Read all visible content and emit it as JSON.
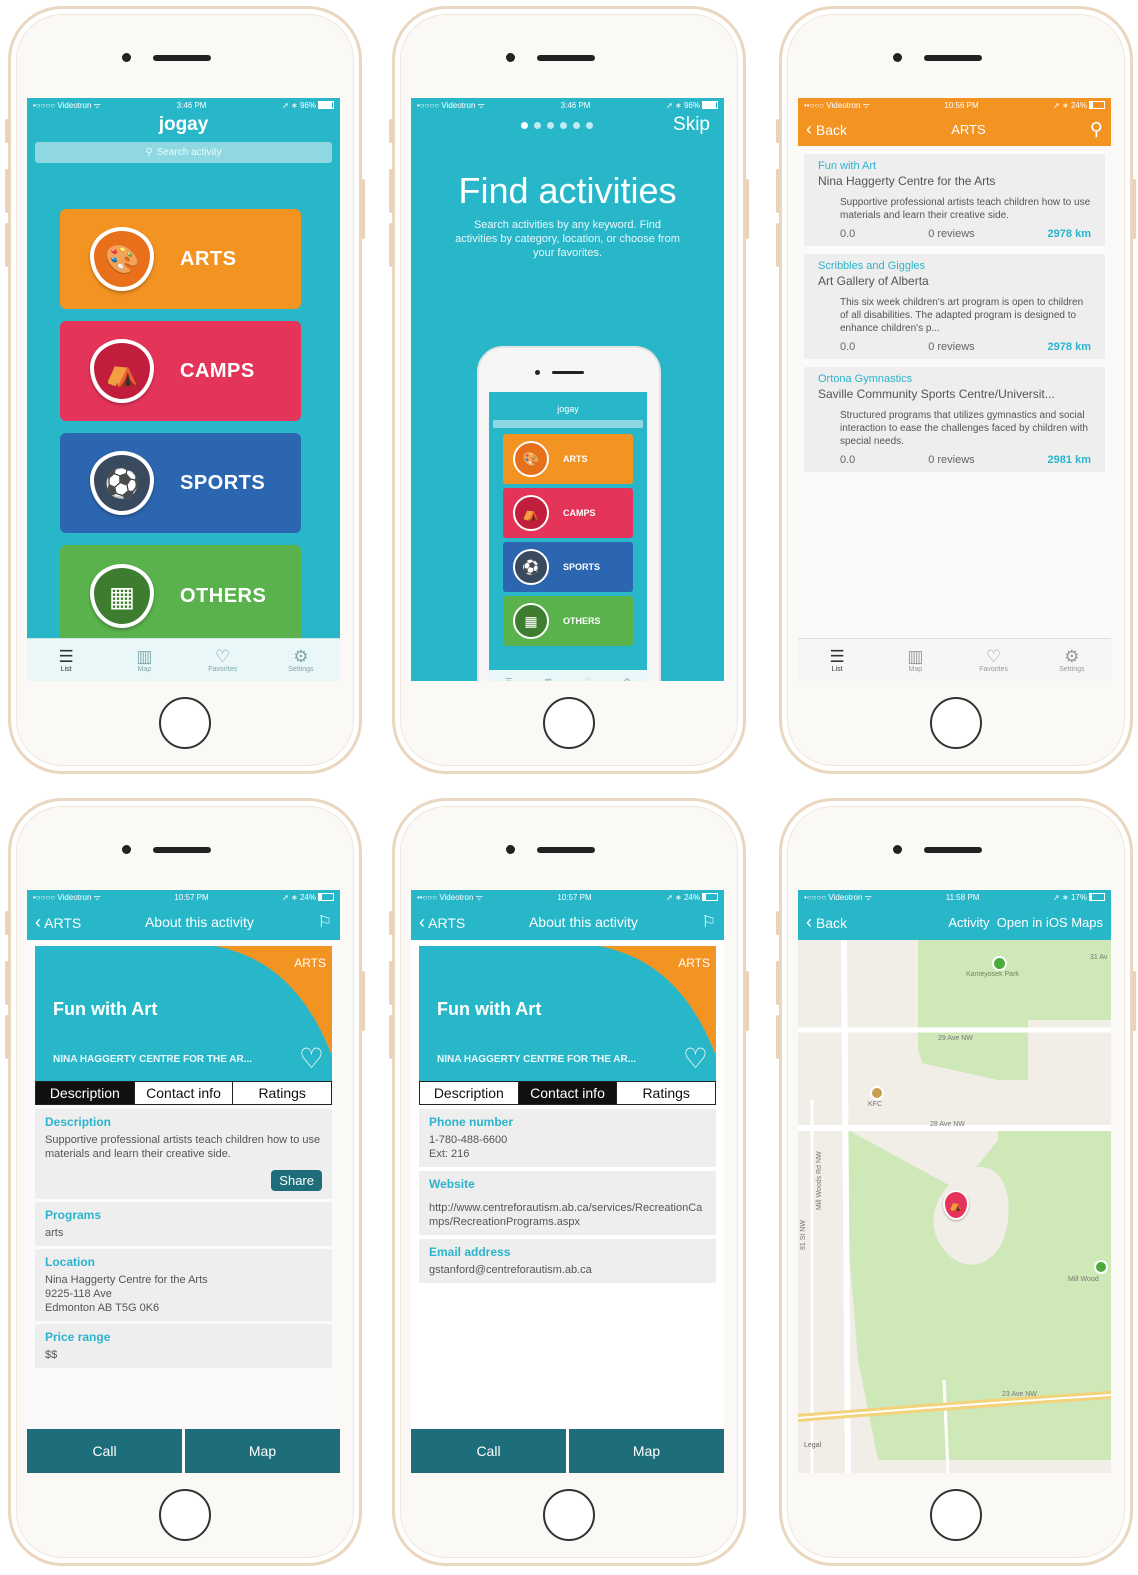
{
  "colors": {
    "teal": "#28b7c9",
    "orange": "#f39322",
    "red": "#e5345a",
    "blue": "#2c66b0",
    "green": "#5ab24c",
    "dark_teal": "#1d6e7a"
  },
  "status": {
    "s1": {
      "carrier": "•○○○○ Videotron ᯤ",
      "time": "3:46 PM",
      "right": "➚ ∗ 96%"
    },
    "s2": {
      "carrier": "•○○○○ Videotron ᯤ",
      "time": "3:46 PM",
      "right": "➚ ∗ 96%"
    },
    "s3": {
      "carrier": "••○○○ Videotron ᯤ",
      "time": "10:56 PM",
      "right": "➚ ∗ 24%"
    },
    "s4": {
      "carrier": "•○○○○ Videotron ᯤ",
      "time": "10:57 PM",
      "right": "➚ ∗ 24%"
    },
    "s5": {
      "carrier": "••○○○ Videotron ᯤ",
      "time": "10:57 PM",
      "right": "➚ ∗ 24%"
    },
    "s6": {
      "carrier": "•○○○○ Videotron ᯤ",
      "time": "11:58 PM",
      "right": "➚ ∗ 17%"
    }
  },
  "home": {
    "logo": "jogay",
    "search_placeholder": "Search activity",
    "categories": [
      {
        "label": "ARTS",
        "icon": "palette-icon",
        "glyph": "🎨"
      },
      {
        "label": "CAMPS",
        "icon": "tent-icon",
        "glyph": "⛺"
      },
      {
        "label": "SPORTS",
        "icon": "basketball-icon",
        "glyph": "⚽"
      },
      {
        "label": "OTHERS",
        "icon": "theater-icon",
        "glyph": "▦"
      }
    ]
  },
  "tabs": [
    {
      "label": "List",
      "glyph": "☰"
    },
    {
      "label": "Map",
      "glyph": "▥"
    },
    {
      "label": "Favorites",
      "glyph": "♡"
    },
    {
      "label": "Settings",
      "glyph": "⚙"
    }
  ],
  "onboarding": {
    "skip": "Skip",
    "title": "Find activities",
    "subtitle": "Search activities by any keyword. Find activities by category, location, or choose from your favorites.",
    "mini_logo": "jogay",
    "mini_categories": [
      "ARTS",
      "CAMPS",
      "SPORTS",
      "OTHERS"
    ]
  },
  "list": {
    "back": "Back",
    "title": "ARTS",
    "items": [
      {
        "title": "Fun with Art",
        "venue": "Nina Haggerty Centre for the Arts",
        "desc": "Supportive professional artists teach children how to use materials and learn their creative side.",
        "rating": "0.0",
        "reviews": "0 reviews",
        "distance": "2978 km"
      },
      {
        "title": "Scribbles and Giggles",
        "venue": "Art Gallery of Alberta",
        "desc": "This six week children's art program is open to children of all disabilities. The adapted program is designed to enhance children's p...",
        "rating": "0.0",
        "reviews": "0 reviews",
        "distance": "2978 km"
      },
      {
        "title": "Ortona Gymnastics",
        "venue": "Saville Community Sports Centre/Universit...",
        "desc": "Structured programs that utilizes gymnastics and social interaction to ease the challenges faced by children with special needs.",
        "rating": "0.0",
        "reviews": "0 reviews",
        "distance": "2981 km"
      }
    ]
  },
  "detail": {
    "back": "ARTS",
    "title": "About this activity",
    "category": "ARTS",
    "activity": "Fun with Art",
    "venue": "NINA HAGGERTY CENTRE FOR THE AR...",
    "segments": [
      "Description",
      "Contact info",
      "Ratings"
    ],
    "description_h": "Description",
    "description": "Supportive professional artists teach children how to use materials and learn their creative side.",
    "share": "Share",
    "programs_h": "Programs",
    "programs": "arts",
    "location_h": "Location",
    "location": [
      "Nina Haggerty Centre for the Arts",
      "9225-118 Ave",
      "Edmonton AB T5G 0K6"
    ],
    "price_h": "Price range",
    "price": "$$",
    "call": "Call",
    "map": "Map"
  },
  "contact": {
    "phone_h": "Phone number",
    "phone": [
      "1-780-488-6600",
      "Ext: 216"
    ],
    "website_h": "Website",
    "website": "http://www.centreforautism.ab.ca/services/RecreationCamps/RecreationPrograms.aspx",
    "email_h": "Email address",
    "email": "gstanford@centreforautism.ab.ca"
  },
  "map": {
    "back": "Back",
    "activity": "Activity",
    "open": "Open in iOS Maps",
    "labels": {
      "park": "Kameyosek Park",
      "kfc": "KFC",
      "ave29": "29 Ave NW",
      "ave28": "28 Ave NW",
      "ave23": "23 Ave NW",
      "mill": "Mill Woods Rd NW",
      "mill2": "Mill Wood",
      "st": "91 St NW",
      "legal": "Legal",
      "st2": "31 Av"
    }
  }
}
